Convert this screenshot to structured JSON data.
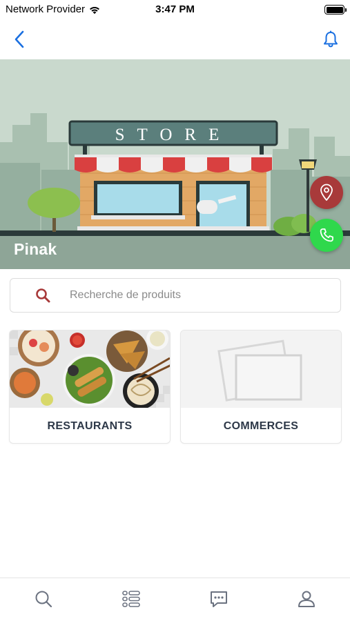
{
  "status_bar": {
    "carrier": "Network Provider",
    "time": "3:47 PM",
    "wifi_icon": "wifi-icon",
    "battery_icon": "battery-icon"
  },
  "nav_bar": {
    "back_icon": "chevron-left-icon",
    "notification_icon": "bell-icon",
    "accent_color": "#1a6fe0"
  },
  "hero": {
    "store_sign": "STORE",
    "store_name": "Pinak",
    "location_icon": "map-pin-icon",
    "location_color": "#a83a3a",
    "phone_icon": "phone-icon",
    "phone_color": "#2fd84c"
  },
  "search": {
    "placeholder": "Recherche de produits",
    "icon": "search-icon",
    "icon_color": "#a83a3a"
  },
  "categories": [
    {
      "label": "RESTAURANTS",
      "image": "food-platter-image"
    },
    {
      "label": "COMMERCES",
      "image": "image-placeholder-icon"
    }
  ],
  "tab_bar": {
    "tabs": [
      {
        "icon": "search-icon"
      },
      {
        "icon": "list-icon"
      },
      {
        "icon": "chat-icon"
      },
      {
        "icon": "user-icon"
      }
    ],
    "icon_color": "#6b7280"
  }
}
